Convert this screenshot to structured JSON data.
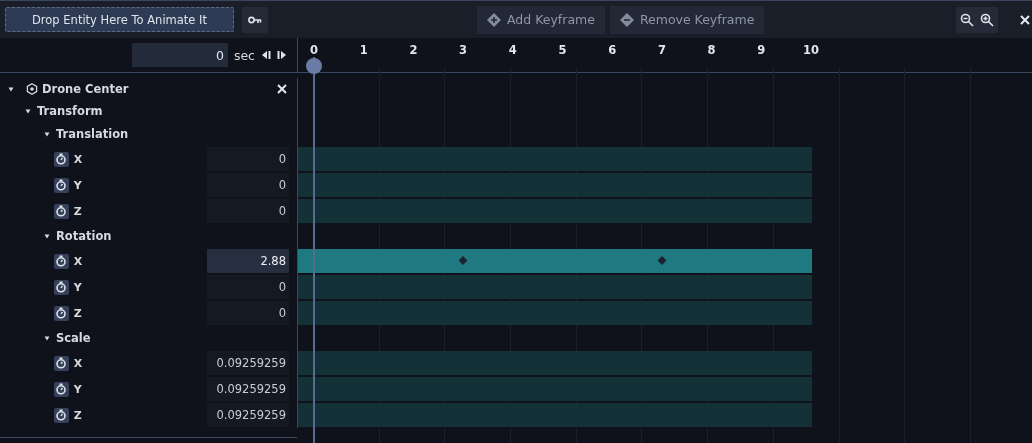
{
  "toolbar": {
    "drop_target": "Drop Entity Here To Animate It",
    "add_keyframe": "Add Keyframe",
    "remove_keyframe": "Remove Keyframe"
  },
  "time_field": {
    "value": "0",
    "unit": "sec"
  },
  "ruler": {
    "ticks": [
      "0",
      "1",
      "2",
      "3",
      "4",
      "5",
      "6",
      "7",
      "8",
      "9",
      "10"
    ]
  },
  "entity": {
    "name": "Drone Center",
    "expanded": true,
    "children": [
      {
        "name": "Transform",
        "expanded": true,
        "children": [
          {
            "name": "Translation",
            "expanded": true,
            "channels": [
              {
                "label": "X",
                "value": "0",
                "selected": false
              },
              {
                "label": "Y",
                "value": "0",
                "selected": false
              },
              {
                "label": "Z",
                "value": "0",
                "selected": false
              }
            ]
          },
          {
            "name": "Rotation",
            "expanded": true,
            "channels": [
              {
                "label": "X",
                "value": "2.88",
                "selected": true,
                "keyframes": [
                  {
                    "level": 0.3
                  },
                  {
                    "level": 0.7
                  }
                ]
              },
              {
                "label": "Y",
                "value": "0",
                "selected": false
              },
              {
                "label": "Z",
                "value": "0",
                "selected": false
              }
            ]
          },
          {
            "name": "Scale",
            "expanded": true,
            "channels": [
              {
                "label": "X",
                "value": "0.09259259",
                "selected": false
              },
              {
                "label": "Y",
                "value": "0.09259259",
                "selected": false
              },
              {
                "label": "Z",
                "value": "0.09259259",
                "selected": false
              }
            ]
          }
        ]
      }
    ]
  }
}
